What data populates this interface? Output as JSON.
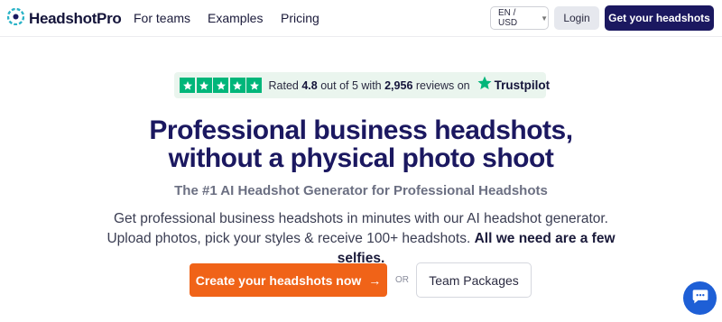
{
  "header": {
    "logo_text": "HeadshotPro",
    "nav": [
      {
        "label": "For teams"
      },
      {
        "label": "Examples"
      },
      {
        "label": "Pricing"
      }
    ],
    "language_select": {
      "value": "EN / USD",
      "icon": "chevron-down-icon"
    },
    "login_label": "Login",
    "cta_label": "Get your headshots"
  },
  "trust": {
    "rated_prefix": "Rated",
    "rating": "4.8",
    "rated_middle": "out of 5 with",
    "review_count": "2,956",
    "rated_suffix": "reviews on",
    "brand": "Trustpilot",
    "star_count": 5,
    "star_color": "#00b67a"
  },
  "hero": {
    "title_line1": "Professional business headshots,",
    "title_line2": "without a physical photo shoot",
    "subtitle": "The #1 AI Headshot Generator for Professional Headshots",
    "description": "Get professional business headshots in minutes with our AI headshot generator. Upload photos, pick your styles & receive 100+ headshots.",
    "description_bold": "All we need are a few selfies."
  },
  "actions": {
    "primary_label": "Create your headshots now",
    "primary_icon": "arrow-right-icon",
    "or_label": "OR",
    "secondary_label": "Team Packages"
  },
  "chat": {
    "icon": "chat-bubble-icon"
  },
  "colors": {
    "brand_dark": "#1b1860",
    "accent_orange": "#f06318",
    "trustpilot_green": "#00b67a",
    "chat_blue": "#1e5fd6"
  }
}
